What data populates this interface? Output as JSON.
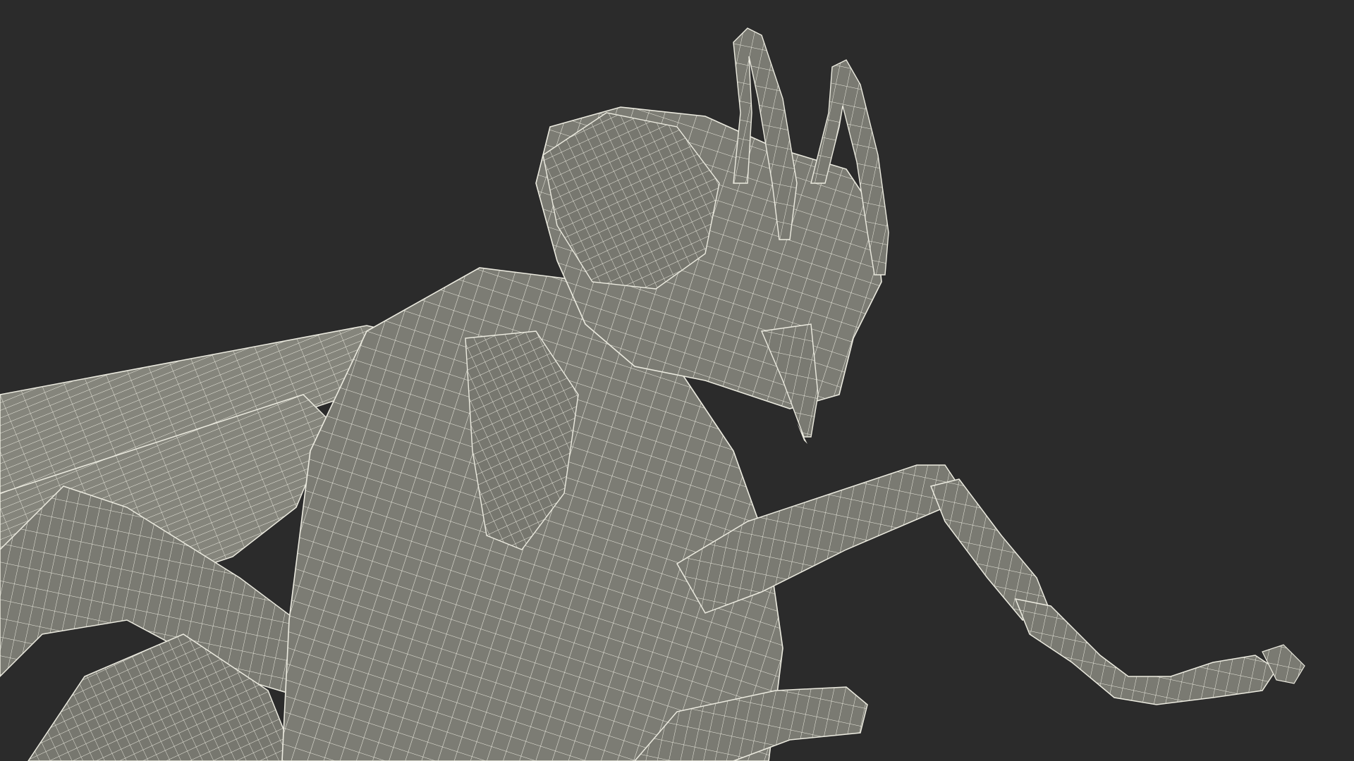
{
  "scene": {
    "subject": "insect-wireframe-model",
    "background_color": "#2b2b2b",
    "surface_color": "#7c7c74",
    "surface_shadow_color": "#5f5f58",
    "wire_color": "#ecebe0"
  }
}
